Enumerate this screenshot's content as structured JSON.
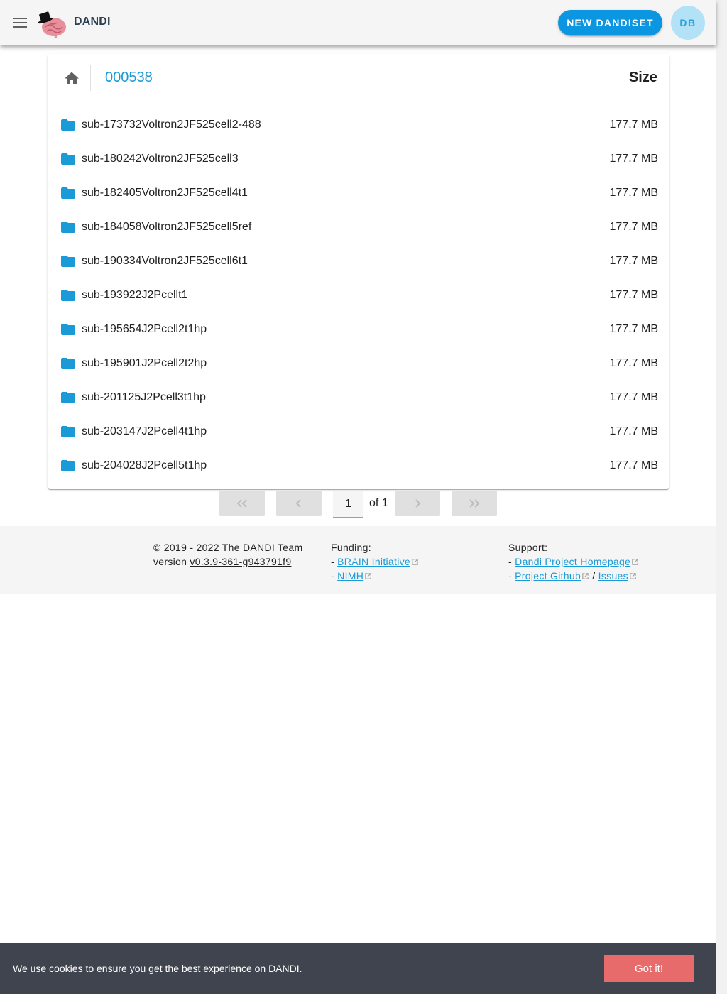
{
  "app": {
    "brand": "DANDI",
    "new_dandiset_label": "NEW DANDISET",
    "avatar_initials": "DB",
    "accent_color": "#0a96e0"
  },
  "browser": {
    "dandiset_id": "000538",
    "size_header": "Size",
    "files": [
      {
        "name": "sub-173732Voltron2JF525cell2-488",
        "size": "177.7 MB",
        "icon": "folder-icon"
      },
      {
        "name": "sub-180242Voltron2JF525cell3",
        "size": "177.7 MB",
        "icon": "folder-icon"
      },
      {
        "name": "sub-182405Voltron2JF525cell4t1",
        "size": "177.7 MB",
        "icon": "folder-icon"
      },
      {
        "name": "sub-184058Voltron2JF525cell5ref",
        "size": "177.7 MB",
        "icon": "folder-icon"
      },
      {
        "name": "sub-190334Voltron2JF525cell6t1",
        "size": "177.7 MB",
        "icon": "folder-icon"
      },
      {
        "name": "sub-193922J2Pcellt1",
        "size": "177.7 MB",
        "icon": "folder-icon"
      },
      {
        "name": "sub-195654J2Pcell2t1hp",
        "size": "177.7 MB",
        "icon": "folder-icon"
      },
      {
        "name": "sub-195901J2Pcell2t2hp",
        "size": "177.7 MB",
        "icon": "folder-icon"
      },
      {
        "name": "sub-201125J2Pcell3t1hp",
        "size": "177.7 MB",
        "icon": "folder-icon"
      },
      {
        "name": "sub-203147J2Pcell4t1hp",
        "size": "177.7 MB",
        "icon": "folder-icon"
      },
      {
        "name": "sub-204028J2Pcell5t1hp",
        "size": "177.7 MB",
        "icon": "folder-icon"
      }
    ]
  },
  "pagination": {
    "current_page": "1",
    "of_text": "of 1"
  },
  "footer": {
    "copyright": "© 2019 - 2022 The DANDI Team",
    "version_prefix": "version ",
    "version": "v0.3.9-361-g943791f9",
    "funding_title": "Funding:",
    "funding_links": [
      "BRAIN Initiative",
      "NIMH"
    ],
    "support_title": "Support:",
    "support_homepage": "Dandi Project Homepage",
    "support_github": "Project Github",
    "support_separator": " / ",
    "support_issues": "Issues",
    "bullet": "- "
  },
  "cookie_banner": {
    "text": "We use cookies to ensure you get the best experience on DANDI.",
    "button": "Got it!"
  }
}
